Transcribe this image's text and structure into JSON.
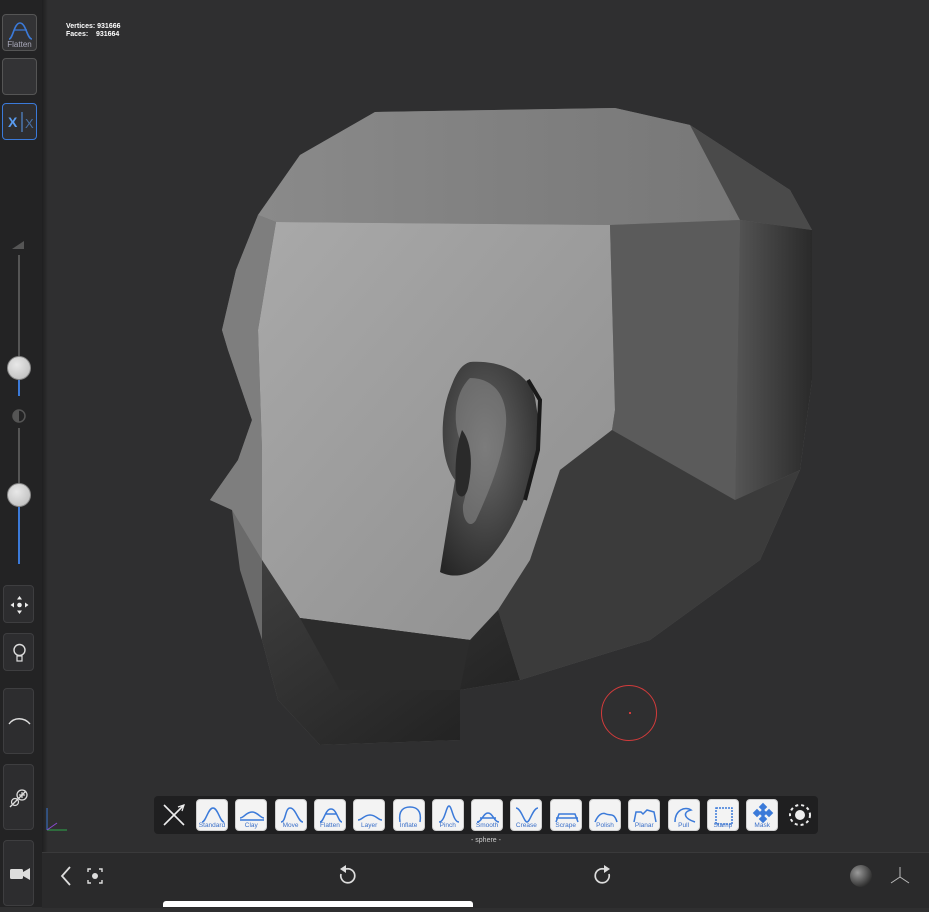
{
  "stats": {
    "vertices_label": "Vertices:",
    "vertices_value": "931666",
    "faces_label": "Faces:",
    "faces_value": "931664"
  },
  "left_toolbar": {
    "current_tool_label": "Flatten",
    "symmetry_label": "X"
  },
  "brushes": [
    {
      "label": "Standard"
    },
    {
      "label": "Clay"
    },
    {
      "label": "Move"
    },
    {
      "label": "Flatten"
    },
    {
      "label": "Layer"
    },
    {
      "label": "Inflate"
    },
    {
      "label": "Pinch"
    },
    {
      "label": "Smooth"
    },
    {
      "label": "Crease"
    },
    {
      "label": "Scrape"
    },
    {
      "label": "Polish"
    },
    {
      "label": "Planar"
    },
    {
      "label": "Pull"
    },
    {
      "label": "Stamp"
    },
    {
      "label": "Mask"
    }
  ],
  "material_label": "- sphere -",
  "colors": {
    "accent": "#3b7ad9",
    "cursor": "#d23b3b",
    "background": "#2f2f30"
  }
}
